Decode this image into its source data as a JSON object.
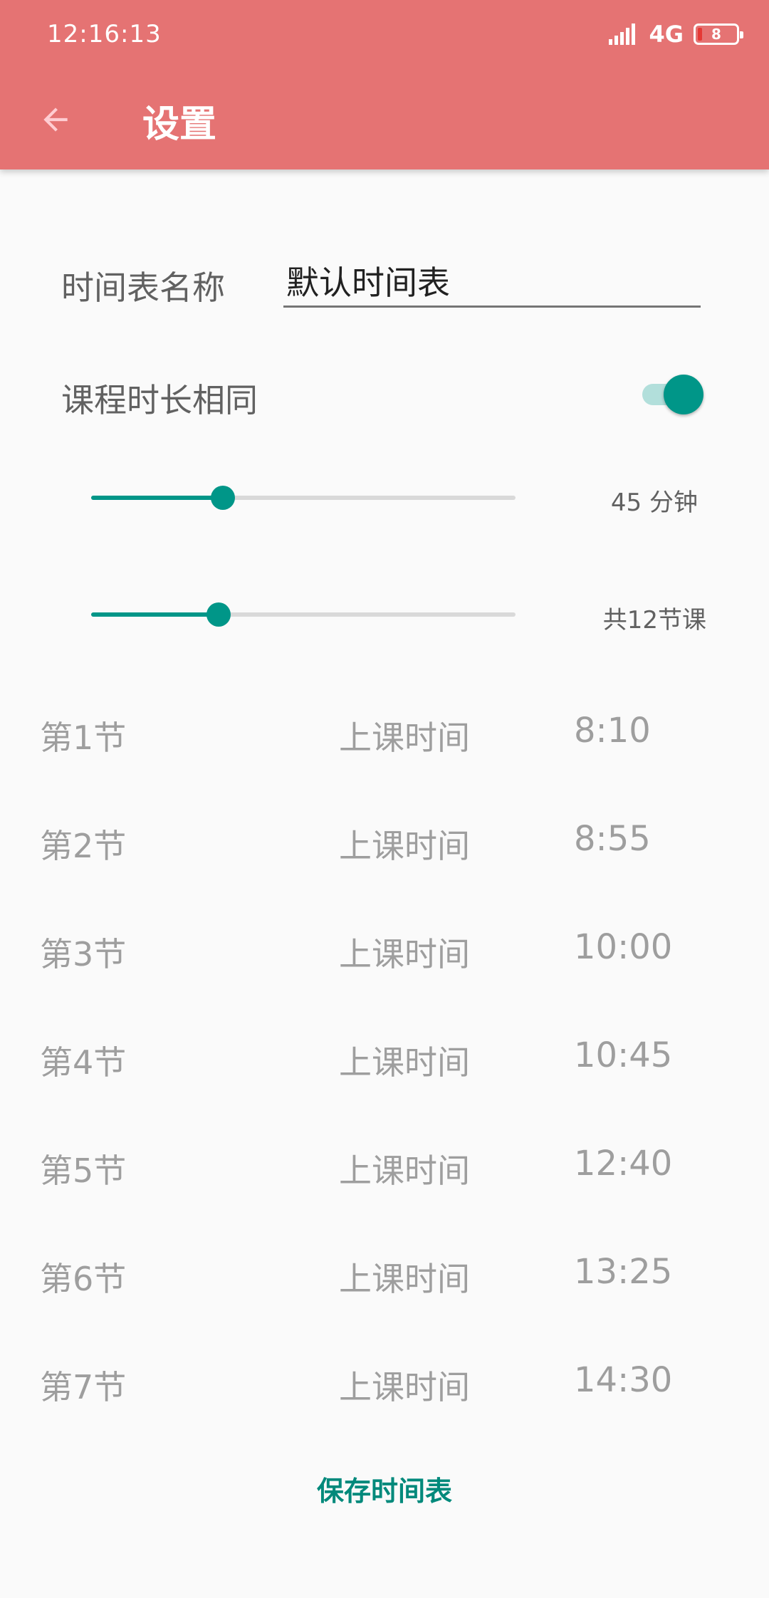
{
  "status_bar": {
    "time": "12:16:13",
    "network": "4G",
    "battery_level": "8"
  },
  "toolbar": {
    "title": "设置",
    "back_icon": "arrow-back-icon"
  },
  "timetable_name": {
    "label": "时间表名称",
    "value": "默认时间表"
  },
  "same_duration": {
    "label": "课程时长相同",
    "enabled": true
  },
  "duration_slider": {
    "value_text": "45 分钟",
    "fraction": 0.31
  },
  "lesson_count_slider": {
    "value_text": "共12节课",
    "fraction": 0.3
  },
  "lessons": [
    {
      "name": "第1节",
      "label": "上课时间",
      "time": "8:10"
    },
    {
      "name": "第2节",
      "label": "上课时间",
      "time": "8:55"
    },
    {
      "name": "第3节",
      "label": "上课时间",
      "time": "10:00"
    },
    {
      "name": "第4节",
      "label": "上课时间",
      "time": "10:45"
    },
    {
      "name": "第5节",
      "label": "上课时间",
      "time": "12:40"
    },
    {
      "name": "第6节",
      "label": "上课时间",
      "time": "13:25"
    },
    {
      "name": "第7节",
      "label": "上课时间",
      "time": "14:30"
    }
  ],
  "save_label": "保存时间表",
  "colors": {
    "app_bar": "#e57373",
    "accent": "#009688",
    "accent_light": "#b2dfdb",
    "save_text": "#00897b"
  }
}
